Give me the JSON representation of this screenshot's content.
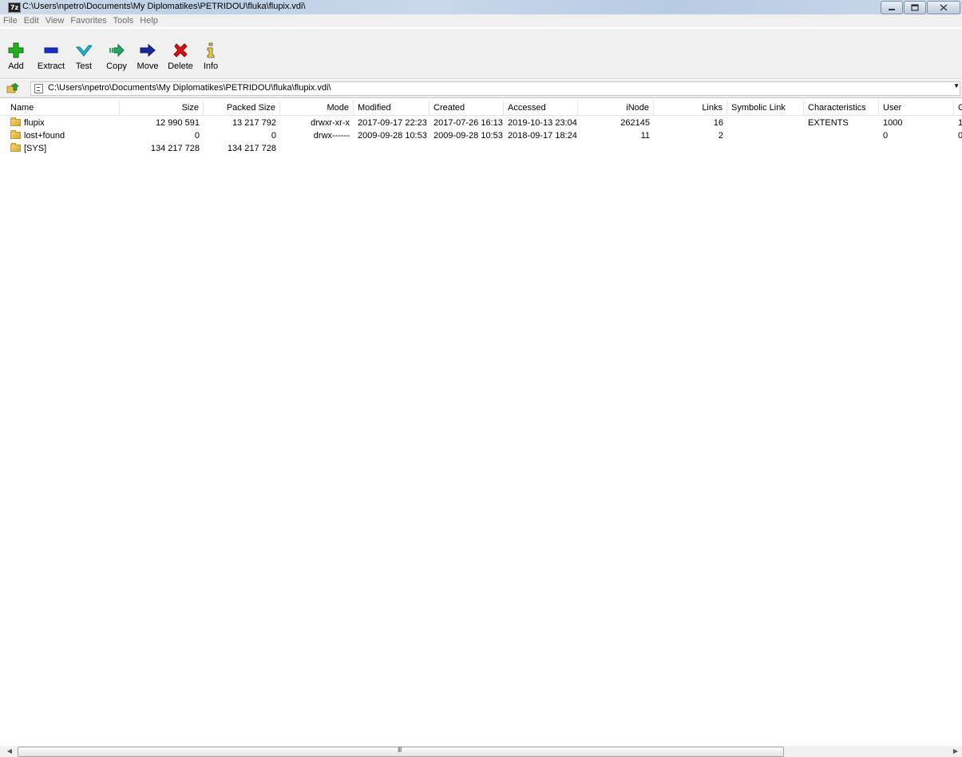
{
  "window": {
    "title": "C:\\Users\\npetro\\Documents\\My Diplomatikes\\PETRIDOU\\fluka\\flupix.vdi\\",
    "app_icon_text": "7z",
    "controls": [
      "minimize",
      "maximize",
      "close"
    ]
  },
  "menu": [
    "File",
    "Edit",
    "View",
    "Favorites",
    "Tools",
    "Help"
  ],
  "toolbar": [
    {
      "label": "Add",
      "icon": "plus-icon",
      "color": "#22b022"
    },
    {
      "label": "Extract",
      "icon": "minus-icon",
      "color": "#1a2ec8"
    },
    {
      "label": "Test",
      "icon": "check-icon",
      "color": "#1bb8d8"
    },
    {
      "label": "Copy",
      "icon": "copy-arrow-icon",
      "color": "#2aa860"
    },
    {
      "label": "Move",
      "icon": "move-arrow-icon",
      "color": "#1a2a9c"
    },
    {
      "label": "Delete",
      "icon": "delete-x-icon",
      "color": "#e01010"
    },
    {
      "label": "Info",
      "icon": "info-icon",
      "color": "#d8c020"
    }
  ],
  "address": {
    "path": "C:\\Users\\npetro\\Documents\\My Diplomatikes\\PETRIDOU\\fluka\\flupix.vdi\\"
  },
  "columns": [
    "Name",
    "Size",
    "Packed Size",
    "Mode",
    "Modified",
    "Created",
    "Accessed",
    "iNode",
    "Links",
    "Symbolic Link",
    "Characteristics",
    "User",
    "G"
  ],
  "rows": [
    {
      "name": "flupix",
      "size": "12 990 591",
      "packed": "13 217 792",
      "mode": "drwxr-xr-x",
      "modified": "2017-09-17 22:23",
      "created": "2017-07-26 16:13",
      "accessed": "2019-10-13 23:04",
      "inode": "262145",
      "links": "16",
      "symlink": "",
      "characteristics": "EXTENTS",
      "user": "1000",
      "group": "1"
    },
    {
      "name": "lost+found",
      "size": "0",
      "packed": "0",
      "mode": "drwx------",
      "modified": "2009-09-28 10:53",
      "created": "2009-09-28 10:53",
      "accessed": "2018-09-17 18:24",
      "inode": "11",
      "links": "2",
      "symlink": "",
      "characteristics": "",
      "user": "0",
      "group": "0"
    },
    {
      "name": "[SYS]",
      "size": "134 217 728",
      "packed": "134 217 728",
      "mode": "",
      "modified": "",
      "created": "",
      "accessed": "",
      "inode": "",
      "links": "",
      "symlink": "",
      "characteristics": "",
      "user": "",
      "group": ""
    }
  ],
  "scrollbar": {
    "grip": "III"
  }
}
